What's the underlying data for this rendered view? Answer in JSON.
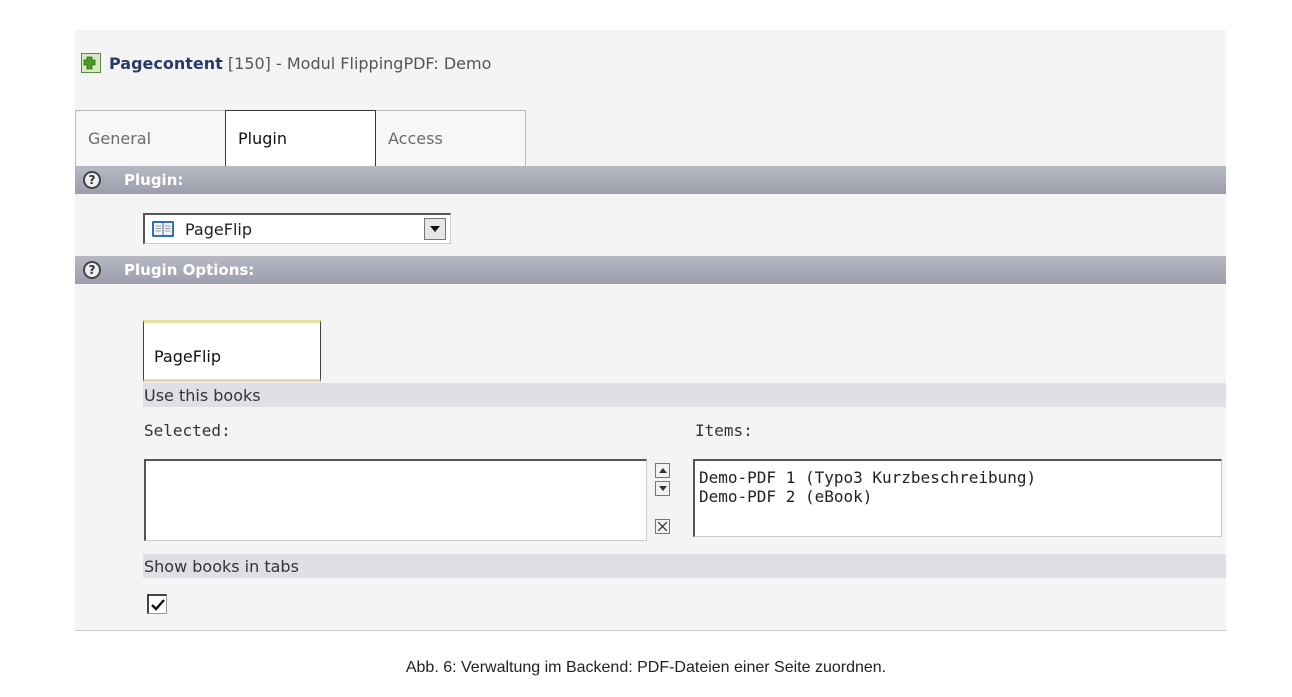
{
  "header": {
    "title_bold": "Pagecontent",
    "title_rest": " [150] - Modul FlippingPDF: Demo"
  },
  "tabs": [
    {
      "label": "General"
    },
    {
      "label": "Plugin"
    },
    {
      "label": "Access"
    }
  ],
  "sections": {
    "plugin": {
      "title": "Plugin:",
      "help": "?"
    },
    "plugin_options": {
      "title": "Plugin Options:",
      "help": "?"
    }
  },
  "plugin_select": {
    "value": "PageFlip"
  },
  "flexform_tab": {
    "label": "PageFlip"
  },
  "books_field": {
    "label": "Use this books",
    "selected_label": "Selected:",
    "items_label": "Items:",
    "selected": [],
    "items": [
      "Demo-PDF 1 (Typo3 Kurzbeschreibung)",
      "Demo-PDF 2 (eBook)"
    ]
  },
  "tabs_field": {
    "label": "Show books in tabs",
    "checked": true
  },
  "caption": "Abb. 6: Verwaltung im Backend: PDF-Dateien einer Seite zuordnen.",
  "colors": {
    "section_bar": "#a8aab6",
    "field_bar": "#dfe0e6",
    "panel_bg": "#f4f4f4",
    "active_tab_border": "#3a3a3a",
    "flex_tab_accent": "#e9df9e"
  }
}
